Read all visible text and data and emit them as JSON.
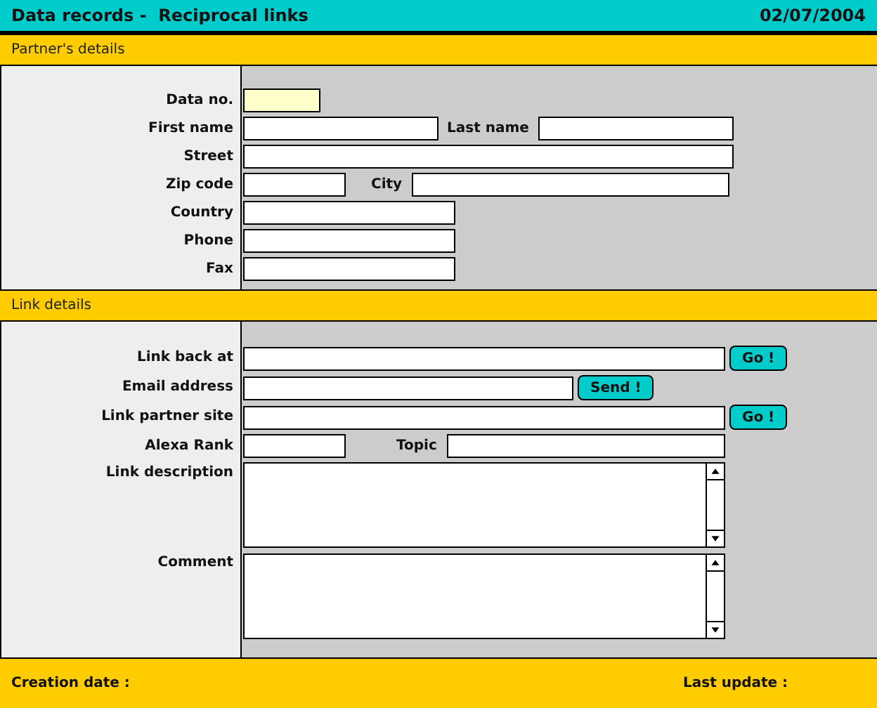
{
  "header": {
    "title": "Data records -  Reciprocal links",
    "date": "02/07/2004"
  },
  "sections": [
    {
      "title": "Partner's details",
      "rows": [
        {
          "label": "Data no.",
          "field": {
            "kind": "number",
            "highlighted": true
          }
        },
        {
          "label": "First name",
          "field": {
            "kind": "name",
            "highlighted": false
          },
          "inline_label": "Last name",
          "second_field": {
            "kind": "lastname",
            "highlighted": false
          }
        },
        {
          "label": "Street",
          "field": {
            "kind": "full",
            "highlighted": false
          }
        },
        {
          "label": "Zip code",
          "field": {
            "kind": "code",
            "highlighted": false
          },
          "inline_label": "City",
          "second_field": {
            "kind": "wide",
            "highlighted": false
          }
        },
        {
          "label": "Country",
          "field": {
            "kind": "medium",
            "highlighted": false
          }
        },
        {
          "label": "Phone",
          "field": {
            "kind": "medium",
            "highlighted": false
          }
        },
        {
          "label": "Fax",
          "field": {
            "kind": "medium",
            "highlighted": false
          }
        }
      ]
    },
    {
      "title": "Link details",
      "rows": [
        {
          "label": "Link back at",
          "field": {
            "kind": "url",
            "highlighted": false
          },
          "button": "Go !"
        },
        {
          "label": "Email address",
          "field": {
            "kind": "email",
            "highlighted": false
          },
          "button": "Send !"
        },
        {
          "label": "Link partner site",
          "field": {
            "kind": "url",
            "highlighted": false
          },
          "button": "Go !"
        },
        {
          "label": "Alexa Rank",
          "field": {
            "kind": "code",
            "highlighted": false
          },
          "inline_label": "Topic",
          "second_field": {
            "kind": "topic",
            "highlighted": false
          }
        },
        {
          "label": "Link description",
          "field": {
            "kind": "memo",
            "highlighted": false
          }
        },
        {
          "label": "Comment",
          "field": {
            "kind": "memo",
            "highlighted": false
          }
        }
      ]
    }
  ],
  "footer": {
    "created": "Creation date :",
    "updated": "Last update :"
  }
}
